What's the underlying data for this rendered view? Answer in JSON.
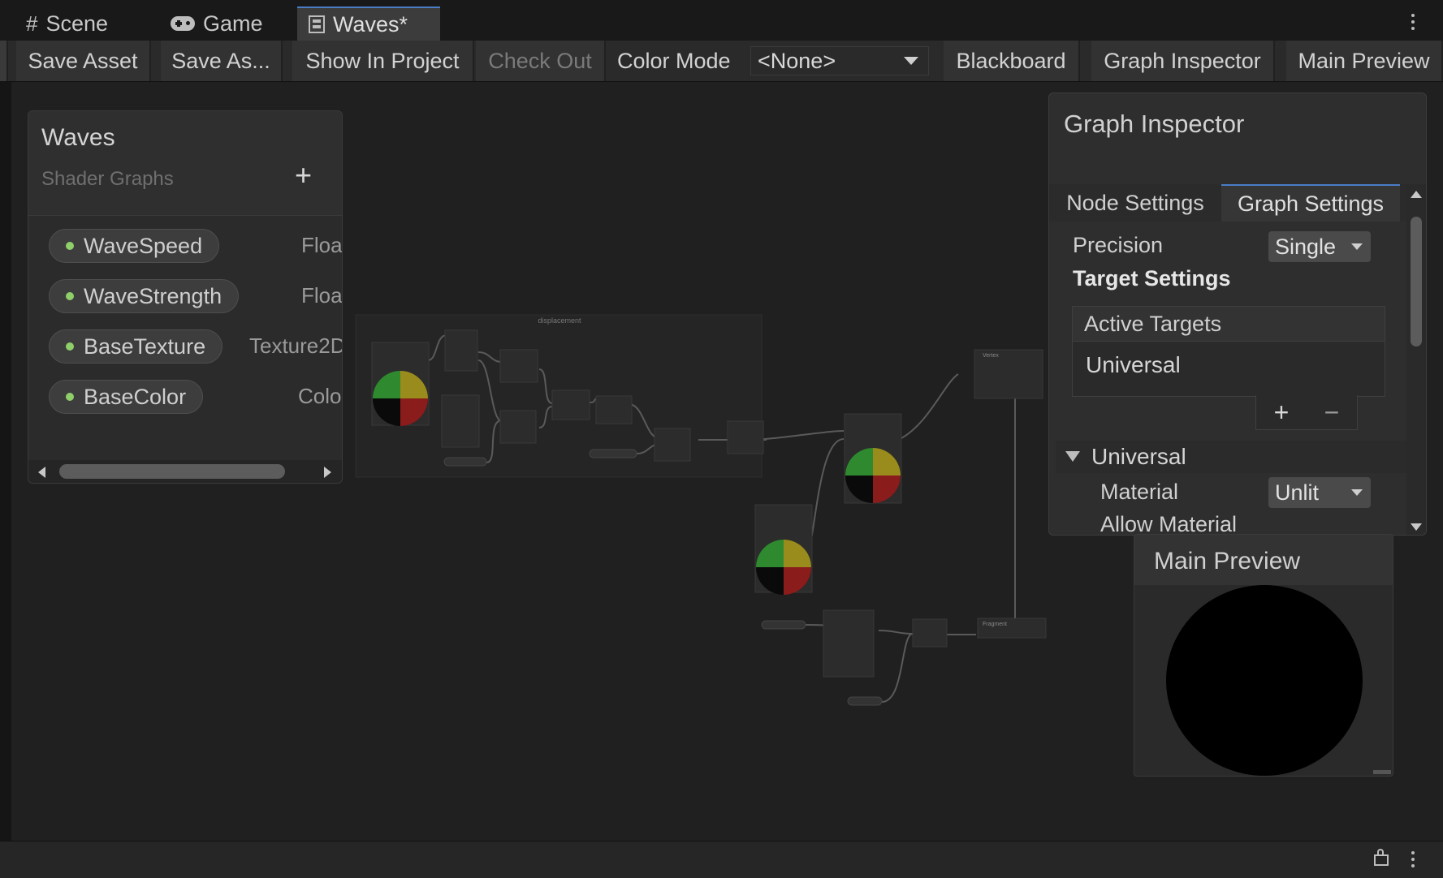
{
  "tabs": [
    {
      "label": "Scene",
      "icon": "hash-icon"
    },
    {
      "label": "Game",
      "icon": "gamepad-icon"
    },
    {
      "label": "Waves*",
      "icon": "shadergraph-icon",
      "active": true
    }
  ],
  "toolbar": {
    "save_asset": "Save Asset",
    "save_as": "Save As...",
    "show_in_project": "Show In Project",
    "check_out": "Check Out",
    "color_mode_label": "Color Mode",
    "color_mode_value": "<None>",
    "blackboard": "Blackboard",
    "graph_inspector": "Graph Inspector",
    "main_preview": "Main Preview"
  },
  "blackboard": {
    "title": "Waves",
    "subtitle": "Shader Graphs",
    "add_label": "+",
    "properties": [
      {
        "name": "WaveSpeed",
        "type": "Floa"
      },
      {
        "name": "WaveStrength",
        "type": "Floa"
      },
      {
        "name": "BaseTexture",
        "type": "Texture2D"
      },
      {
        "name": "BaseColor",
        "type": "Colo"
      }
    ]
  },
  "graph": {
    "group_title": "displacement",
    "vertex_title": "Vertex",
    "fragment_title": "Fragment"
  },
  "inspector": {
    "title": "Graph Inspector",
    "tabs": [
      "Node Settings",
      "Graph Settings"
    ],
    "active_tab": "Graph Settings",
    "precision_label": "Precision",
    "precision_value": "Single",
    "target_settings": "Target Settings",
    "active_targets": "Active Targets",
    "targets": [
      "Universal"
    ],
    "add_label": "+",
    "remove_label": "−",
    "universal_section": "Universal",
    "material_label": "Material",
    "material_value": "Unlit",
    "allow_material": "Allow Material"
  },
  "main_preview": {
    "title": "Main Preview"
  },
  "colors": {
    "accent": "#4a7dc6",
    "property_dot": "#8fcf6a",
    "canvas": "#202020"
  }
}
